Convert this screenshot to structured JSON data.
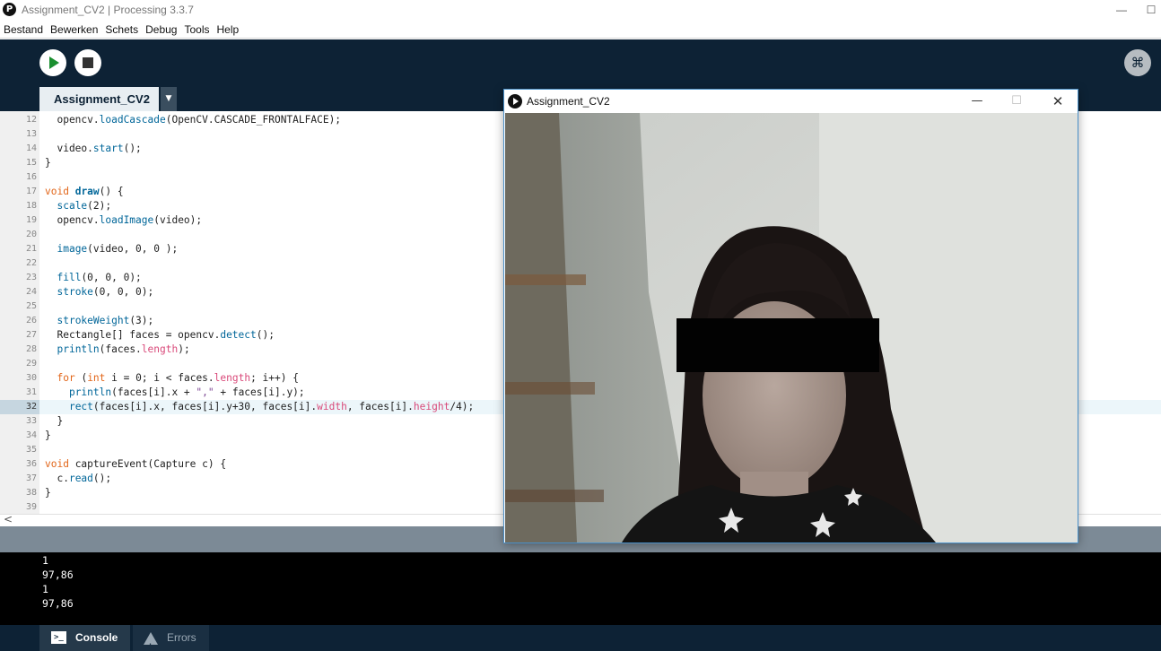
{
  "window": {
    "title": "Assignment_CV2 | Processing 3.3.7",
    "logo": "P",
    "min": "—",
    "max": "☐"
  },
  "menu": [
    "Bestand",
    "Bewerken",
    "Schets",
    "Debug",
    "Tools",
    "Help"
  ],
  "toolbar": {
    "run_icon": "play-icon",
    "stop_icon": "stop-icon",
    "mode_icon": "debug-mode-icon",
    "mode_glyph": "⌘"
  },
  "tab": {
    "label": "Assignment_CV2",
    "arrow": "▼"
  },
  "editor": {
    "active_line": "32",
    "lines": [
      {
        "n": "12",
        "t": "  opencv.loadCascade(OpenCV.CASCADE_FRONTALFACE);"
      },
      {
        "n": "13",
        "t": ""
      },
      {
        "n": "14",
        "t": "  video.start();"
      },
      {
        "n": "15",
        "t": "}"
      },
      {
        "n": "16",
        "t": ""
      },
      {
        "n": "17",
        "t": "void draw() {"
      },
      {
        "n": "18",
        "t": "  scale(2);"
      },
      {
        "n": "19",
        "t": "  opencv.loadImage(video);"
      },
      {
        "n": "20",
        "t": ""
      },
      {
        "n": "21",
        "t": "  image(video, 0, 0 );"
      },
      {
        "n": "22",
        "t": ""
      },
      {
        "n": "23",
        "t": "  fill(0, 0, 0);"
      },
      {
        "n": "24",
        "t": "  stroke(0, 0, 0);"
      },
      {
        "n": "25",
        "t": ""
      },
      {
        "n": "26",
        "t": "  strokeWeight(3);"
      },
      {
        "n": "27",
        "t": "  Rectangle[] faces = opencv.detect();"
      },
      {
        "n": "28",
        "t": "  println(faces.length);"
      },
      {
        "n": "29",
        "t": ""
      },
      {
        "n": "30",
        "t": "  for (int i = 0; i < faces.length; i++) {"
      },
      {
        "n": "31",
        "t": "    println(faces[i].x + \",\" + faces[i].y);"
      },
      {
        "n": "32",
        "t": "    rect(faces[i].x, faces[i].y+30, faces[i].width, faces[i].height/4);"
      },
      {
        "n": "33",
        "t": "  }"
      },
      {
        "n": "34",
        "t": "}"
      },
      {
        "n": "35",
        "t": ""
      },
      {
        "n": "36",
        "t": "void captureEvent(Capture c) {"
      },
      {
        "n": "37",
        "t": "  c.read();"
      },
      {
        "n": "38",
        "t": "}"
      },
      {
        "n": "39",
        "t": ""
      }
    ]
  },
  "scroll": {
    "left_arrow": "<"
  },
  "console": {
    "lines": [
      "1",
      "97,86",
      "1",
      "97,86"
    ]
  },
  "footer": {
    "console_label": "Console",
    "console_icon_text": ">_",
    "errors_label": "Errors"
  },
  "sketch": {
    "title": "Assignment_CV2",
    "min": "—",
    "max": "☐",
    "close": "✕"
  },
  "colors": {
    "toolbar_bg": "#0d2235",
    "keyword": "#e2661a",
    "function": "#006699",
    "string": "#7d4793",
    "property": "#d94a7a",
    "console_bg": "#000000"
  }
}
